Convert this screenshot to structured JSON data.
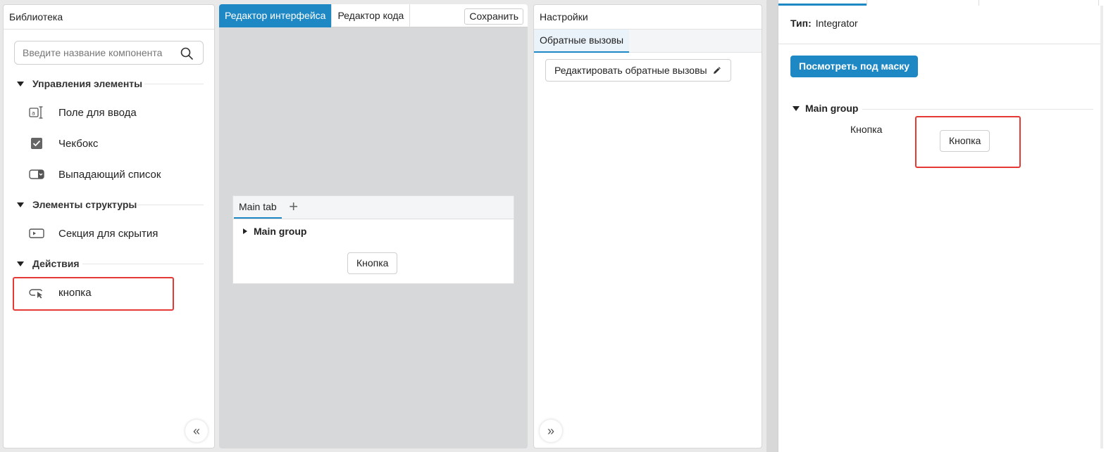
{
  "library": {
    "title": "Библиотека",
    "search_placeholder": "Введите название компонента",
    "sections": [
      {
        "title": "Управления элементы",
        "items": [
          {
            "label": "Поле для ввода",
            "icon": "text-input-icon"
          },
          {
            "label": "Чекбокс",
            "icon": "checkbox-icon"
          },
          {
            "label": "Выпадающий список",
            "icon": "dropdown-icon"
          }
        ]
      },
      {
        "title": "Элементы структуры",
        "items": [
          {
            "label": "Секция для скрытия",
            "icon": "collapsible-section-icon"
          }
        ]
      },
      {
        "title": "Действия",
        "items": [
          {
            "label": "кнопка",
            "icon": "button-click-icon"
          }
        ]
      }
    ],
    "collapse_label": "«"
  },
  "editor": {
    "tabs": [
      "Редактор интерфейса",
      "Редактор кода"
    ],
    "active_tab": 0,
    "save_label": "Сохранить",
    "canvas": {
      "tab_label": "Main tab",
      "add_tab_label": "+",
      "group_title": "Main group",
      "button_label": "Кнопка"
    }
  },
  "settings": {
    "title": "Настройки",
    "subtab": "Обратные вызовы",
    "edit_callbacks_label": "Редактировать обратные вызовы",
    "expand_label": "»"
  },
  "preview": {
    "type_label": "Тип:",
    "type_value": "Integrator",
    "mask_button_label": "Посмотреть под маску",
    "group_title": "Main group",
    "field_label": "Кнопка",
    "button_label": "Кнопка"
  },
  "colors": {
    "accent": "#1e88c5",
    "highlight": "#e53935"
  }
}
